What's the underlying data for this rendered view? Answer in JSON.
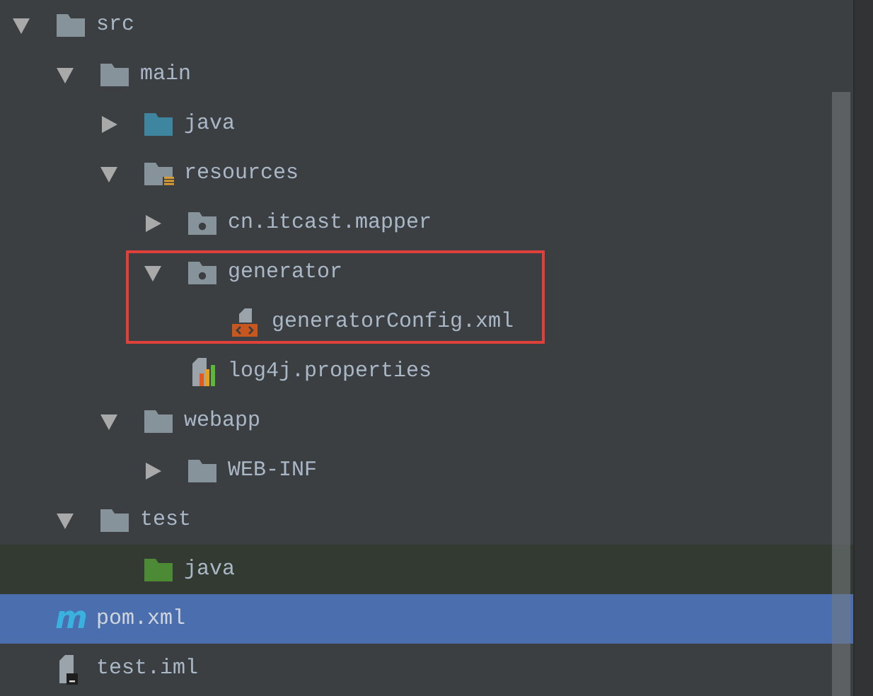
{
  "tree": [
    {
      "label": "src",
      "kind": "folder",
      "expanded": true,
      "selected": false,
      "children": [
        {
          "label": "main",
          "kind": "folder",
          "expanded": true,
          "selected": false,
          "children": [
            {
              "label": "java",
              "kind": "source-folder",
              "expanded": false,
              "selected": false
            },
            {
              "label": "resources",
              "kind": "resource-folder",
              "expanded": true,
              "selected": false,
              "children": [
                {
                  "label": "cn.itcast.mapper",
                  "kind": "package",
                  "expanded": false,
                  "selected": false
                },
                {
                  "label": "generator",
                  "kind": "package",
                  "expanded": true,
                  "selected": false,
                  "boxed": true,
                  "children": [
                    {
                      "label": "generatorConfig.xml",
                      "kind": "xml-file",
                      "selected": false
                    }
                  ]
                },
                {
                  "label": "log4j.properties",
                  "kind": "properties-file",
                  "selected": false
                }
              ]
            },
            {
              "label": "webapp",
              "kind": "folder",
              "expanded": true,
              "selected": false,
              "children": [
                {
                  "label": "WEB-INF",
                  "kind": "folder",
                  "expanded": false,
                  "selected": false
                }
              ]
            }
          ]
        },
        {
          "label": "test",
          "kind": "folder",
          "expanded": true,
          "selected": false,
          "children": [
            {
              "label": "java",
              "kind": "test-folder",
              "selected": false
            }
          ]
        }
      ]
    },
    {
      "label": "pom.xml",
      "kind": "maven-file",
      "icon_text": "m",
      "selected": true
    },
    {
      "label": "test.iml",
      "kind": "module-file",
      "selected": false
    }
  ]
}
